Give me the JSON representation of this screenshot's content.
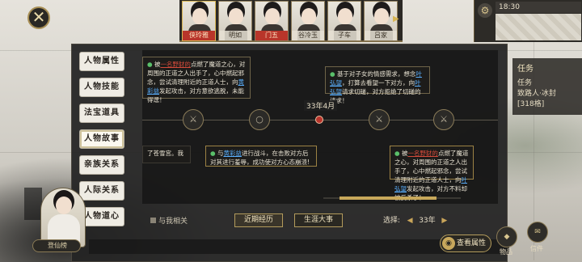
{
  "close_button": {
    "label": "✕"
  },
  "portraits": [
    {
      "name": "侠玲雅",
      "active": true,
      "red": true
    },
    {
      "name": "明如",
      "active": false,
      "red": false
    },
    {
      "name": "门五",
      "active": false,
      "red": true
    },
    {
      "name": "谷冷玉",
      "active": false,
      "red": false
    },
    {
      "name": "子车",
      "active": false,
      "red": false
    },
    {
      "name": "吕家",
      "active": false,
      "red": false
    }
  ],
  "hud": {
    "clock": "18:30"
  },
  "task_panel": {
    "title": "任务",
    "lines": [
      "任务",
      "致路人·冰封",
      "[318格]"
    ]
  },
  "side_tabs": [
    {
      "label": "人物属性",
      "selected": false
    },
    {
      "label": "人物技能",
      "selected": false
    },
    {
      "label": "法宝道具",
      "selected": false
    },
    {
      "label": "人物故事",
      "selected": true
    },
    {
      "label": "亲族关系",
      "selected": false
    },
    {
      "label": "人际关系",
      "selected": false
    },
    {
      "label": "人物道心",
      "selected": false
    }
  ],
  "timeline": {
    "date_label": "33年4月"
  },
  "events": {
    "e1": {
      "pre": "被",
      "hl1": "一名野豺的",
      "mid": "点燃了魔道之心，对周围的正道之人出手了，心中燃起邪念，尝试清理附近的正道人士，向",
      "hl2": "黄彩益",
      "post": "发起攻击，对方意欲逃脱，未能得逞！"
    },
    "e2": {
      "pre": "基于对子女的情感需求，想念",
      "hl1": "叶弘望",
      "mid": "，打算去看望一下对方，向",
      "hl2": "叶弘望",
      "post": "请求切磋，对方拒绝了切磋的请求！"
    },
    "e3": {
      "text": "了苍雪宫。我"
    },
    "e4": {
      "pre": "与",
      "hl1": "黄彩益",
      "post": "进行战斗，在击败对方后对其进行羞辱，成功使对方心态崩溃!"
    },
    "e5": {
      "pre": "被",
      "hl1": "一名野豺的",
      "mid": "点燃了魔道之心，对周围的正道之人出手了，心中燃起邪念，尝试清理附近的正道人士，向",
      "hl2": "叶弘望",
      "post": "发起攻击，对方不料却被反杀了！"
    }
  },
  "filter": {
    "label": "与我相关"
  },
  "tabs": {
    "recent": "近期经历",
    "life": "生涯大事"
  },
  "year_select": {
    "label": "选择:",
    "value": "33年",
    "left": "◀",
    "right": "▶"
  },
  "char": {
    "name_tag": "登仙榜"
  },
  "view_attr": {
    "label": "查看属性"
  },
  "right_buttons": {
    "shop": "物品",
    "letter": "信件"
  }
}
